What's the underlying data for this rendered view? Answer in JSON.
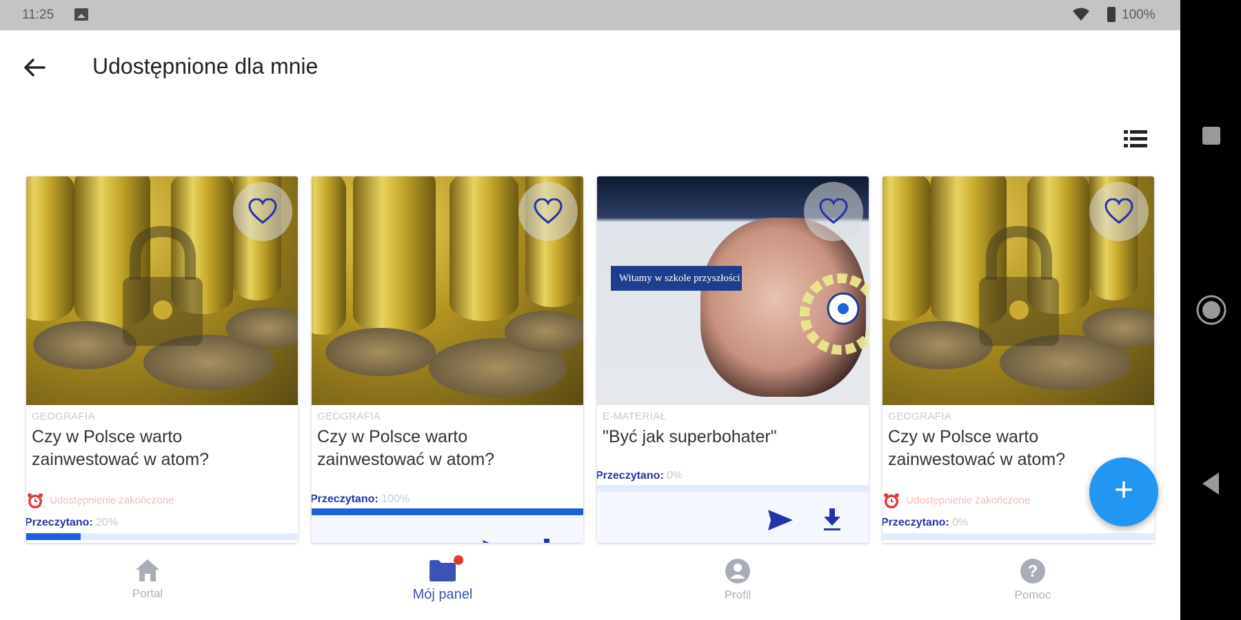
{
  "status_bar": {
    "time": "11:25",
    "battery": "100%"
  },
  "app_bar": {
    "title": "Udostępnione dla mnie"
  },
  "cards": [
    {
      "category": "GEOGRAFIA",
      "title": "Czy w Polsce warto zainwestować w atom?",
      "share_status": "Udostępnienie zakończone",
      "progress_label": "Przeczytano:",
      "progress_value": "20%",
      "progress": 20
    },
    {
      "category": "GEOGRAFIA",
      "title": "Czy w Polsce warto zainwestować w atom?",
      "progress_label": "Przeczytano:",
      "progress_value": "100%",
      "progress": 100
    },
    {
      "category": "E-MATERIAŁ",
      "title": "\"Być jak superbohater\"",
      "banner_text": "Witamy w szkole przyszłości",
      "progress_label": "Przeczytano:",
      "progress_value": "0%",
      "progress": 0
    },
    {
      "category": "GEOGRAFIA",
      "title": "Czy w Polsce warto zainwestować w atom?",
      "share_status": "Udostępnienie zakończone",
      "progress_label": "Przeczytano:",
      "progress_value": "0%",
      "progress": 0
    }
  ],
  "fab": {
    "label": "+"
  },
  "bottom_nav": [
    {
      "label": "Portal",
      "icon": "home-icon"
    },
    {
      "label": "Mój panel",
      "icon": "folder-icon",
      "active": true
    },
    {
      "label": "Profil",
      "icon": "account-icon"
    },
    {
      "label": "Pomoc",
      "icon": "help-icon"
    }
  ],
  "colors": {
    "primary": "#2333a8",
    "accent": "#2196f3",
    "progress": "#1e62d8",
    "badge": "#e53935"
  }
}
